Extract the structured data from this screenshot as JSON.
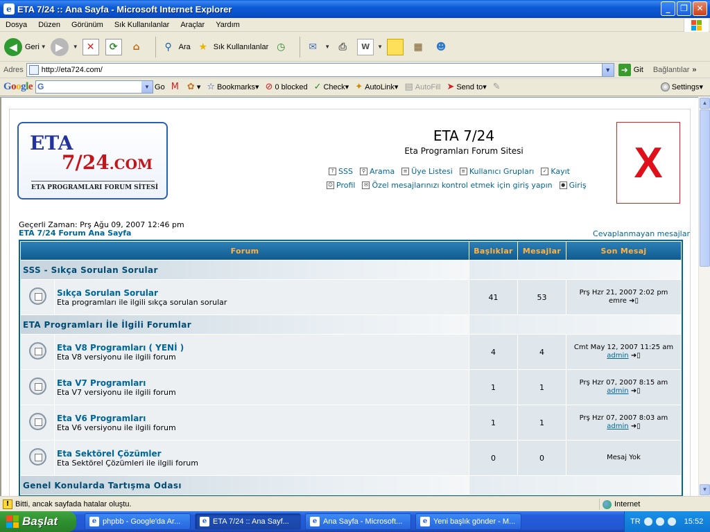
{
  "window": {
    "title": "ETA 7/24 :: Ana Sayfa - Microsoft Internet Explorer"
  },
  "menu": [
    "Dosya",
    "Düzen",
    "Görünüm",
    "Sık Kullanılanlar",
    "Araçlar",
    "Yardım"
  ],
  "toolbar": {
    "back": "Geri",
    "search": "Ara",
    "favorites": "Sık Kullanılanlar"
  },
  "address": {
    "label": "Adres",
    "url": "http://eta724.com/",
    "go": "Git",
    "links": "Bağlantılar",
    "more": "»"
  },
  "google_bar": {
    "logo": "Google",
    "go": "Go",
    "bookmarks": "Bookmarks",
    "blocked": "0 blocked",
    "check": "Check",
    "autolink": "AutoLink",
    "autofill": "AutoFill",
    "send_to": "Send to",
    "settings": "Settings"
  },
  "site": {
    "logo_line1": "ETA",
    "logo_line2_main": "7/24",
    "logo_line2_suffix": ".COM",
    "logo_line3": "ETA PROGRAMLARI FORUM SİTESİ",
    "title": "ETA 7/24",
    "description": "Eta Programları Forum Sitesi",
    "nav_row1": [
      "SSS",
      "Arama",
      "Üye Listesi",
      "Kullanıcı Grupları",
      "Kayıt"
    ],
    "nav_row2": [
      "Profil",
      "Özel mesajlarınızı kontrol etmek için giriş yapın",
      "Giriş"
    ],
    "x_mark": "X",
    "current_time": "Geçerli Zaman: Prş Ağu 09, 2007 12:46 pm",
    "home_link": "ETA 7/24 Forum Ana Sayfa",
    "unanswered": "Cevaplanmayan mesajlar"
  },
  "table": {
    "headers": {
      "forum": "Forum",
      "topics": "Başlıklar",
      "posts": "Mesajlar",
      "last": "Son Mesaj"
    },
    "categories": [
      {
        "name": "SSS - Sıkça Sorulan Sorular",
        "forums": [
          {
            "name": "Sıkça Sorulan Sorular",
            "desc": "Eta programları ile ilgili sıkça sorulan sorular",
            "topics": "41",
            "posts": "53",
            "last_date": "Prş Hzr 21, 2007 2:02 pm",
            "last_user": "emre",
            "user_link": false
          }
        ]
      },
      {
        "name": "ETA Programları İle İlgili Forumlar",
        "forums": [
          {
            "name": "Eta V8 Programları ( YENİ )",
            "desc": "Eta V8 versiyonu ile ilgili forum",
            "topics": "4",
            "posts": "4",
            "last_date": "Cmt May 12, 2007 11:25 am",
            "last_user": "admin",
            "user_link": true
          },
          {
            "name": "Eta V7 Programları",
            "desc": "Eta V7 versiyonu ile ilgili forum",
            "topics": "1",
            "posts": "1",
            "last_date": "Prş Hzr 07, 2007 8:15 am",
            "last_user": "admin",
            "user_link": true
          },
          {
            "name": "Eta V6 Programları",
            "desc": "Eta V6 versiyonu ile ilgili forum",
            "topics": "1",
            "posts": "1",
            "last_date": "Prş Hzr 07, 2007 8:03 am",
            "last_user": "admin",
            "user_link": true
          },
          {
            "name": "Eta Sektörel Çözümler",
            "desc": "Eta Sektörel Çözümleri ile ilgili forum",
            "topics": "0",
            "posts": "0",
            "last_date": "Mesaj Yok",
            "last_user": "",
            "user_link": false
          }
        ]
      },
      {
        "name": "Genel Konularda Tartışma Odası",
        "forums": []
      }
    ]
  },
  "status": {
    "message": "Bitti, ancak sayfada hatalar oluştu.",
    "zone": "Internet"
  },
  "taskbar": {
    "start": "Başlat",
    "tasks": [
      "phpbb - Google'da Ar...",
      "ETA 7/24 :: Ana Sayf...",
      "Ana Sayfa - Microsoft...",
      "Yeni başlık gönder - M..."
    ],
    "lang": "TR",
    "clock": "15:52"
  },
  "colors": {
    "accent": "#006699",
    "header_text": "#ffb347",
    "x_red": "#e0101a"
  }
}
